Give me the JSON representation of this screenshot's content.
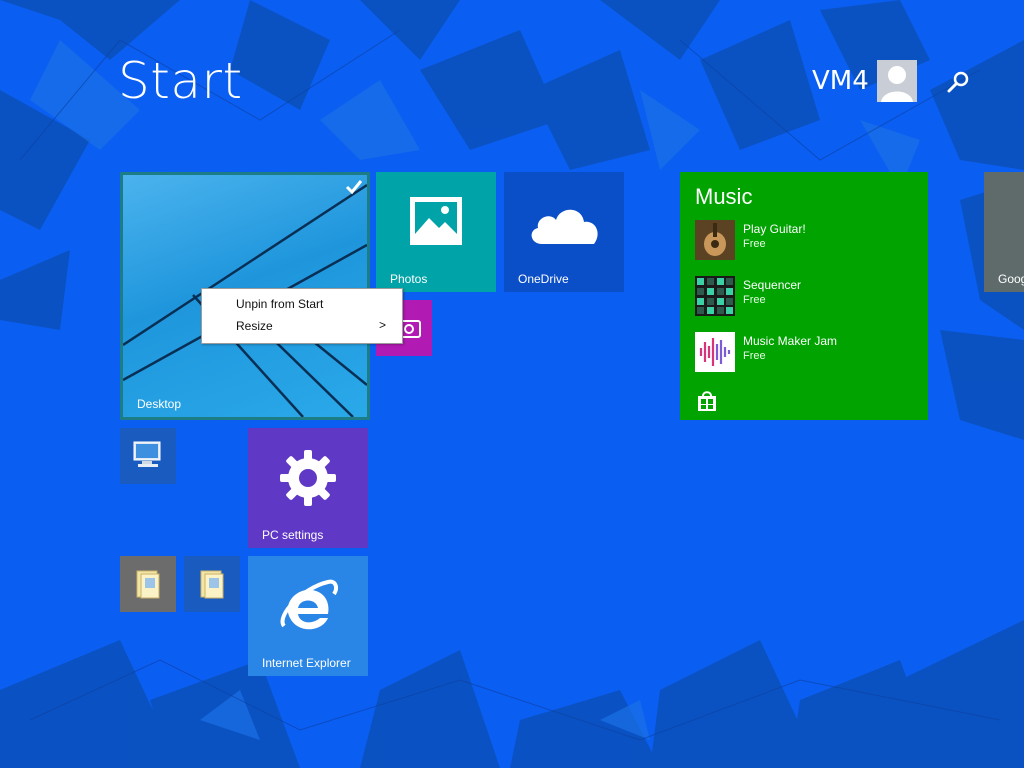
{
  "screen": {
    "title": "Start"
  },
  "user": {
    "name": "VM4"
  },
  "icons": {
    "search": "search-icon",
    "avatar": "user-avatar-icon",
    "check": "checkmark-icon",
    "submenu": "chevron-right-icon"
  },
  "colors": {
    "background": "#0a5ef2",
    "photos": "#00a3a7",
    "onedrive": "#0a4ec8",
    "camera": "#b11ab3",
    "music": "#00a300",
    "pc_settings": "#5f38c6",
    "internet_explorer": "#2a86e6"
  },
  "tiles": {
    "desktop": {
      "label": "Desktop",
      "selected": true
    },
    "photos": {
      "label": "Photos"
    },
    "onedrive": {
      "label": "OneDrive"
    },
    "music": {
      "title": "Music",
      "items": [
        {
          "name": "Play Guitar!",
          "price": "Free"
        },
        {
          "name": "Sequencer",
          "price": "Free"
        },
        {
          "name": "Music Maker Jam",
          "price": "Free"
        }
      ]
    },
    "google": {
      "label": "Goog"
    },
    "pc_settings": {
      "label": "PC settings"
    },
    "internet_explorer": {
      "label": "Internet Explorer"
    }
  },
  "context_menu": {
    "items": [
      {
        "label": "Unpin from Start"
      },
      {
        "label": "Resize",
        "submenu_glyph": ">"
      }
    ]
  }
}
